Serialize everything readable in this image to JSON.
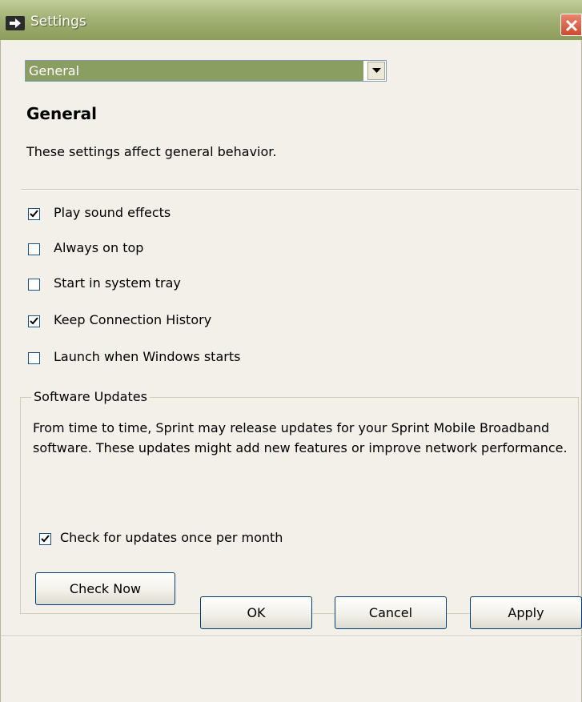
{
  "window": {
    "title": "Settings"
  },
  "category_select": {
    "value": "General"
  },
  "section": {
    "heading": "General",
    "description": "These settings affect general behavior."
  },
  "options": [
    {
      "label": "Play sound effects",
      "checked": true
    },
    {
      "label": "Always on top",
      "checked": false
    },
    {
      "label": "Start in system tray",
      "checked": false
    },
    {
      "label": "Keep Connection History",
      "checked": true
    },
    {
      "label": "Launch when Windows starts",
      "checked": false
    }
  ],
  "updates": {
    "group_title": "Software Updates",
    "text": "From time to time, Sprint may release updates for your Sprint Mobile Broadband software.  These updates might add new features or improve network performance.",
    "monthly_check_label": "Check for updates once per month",
    "monthly_check_checked": true,
    "check_now_label": "Check Now"
  },
  "buttons": {
    "ok": "OK",
    "cancel": "Cancel",
    "apply": "Apply"
  },
  "colors": {
    "titlebar": "#a3b276",
    "select_highlight": "#8a9e62",
    "close": "#cc4a30"
  }
}
